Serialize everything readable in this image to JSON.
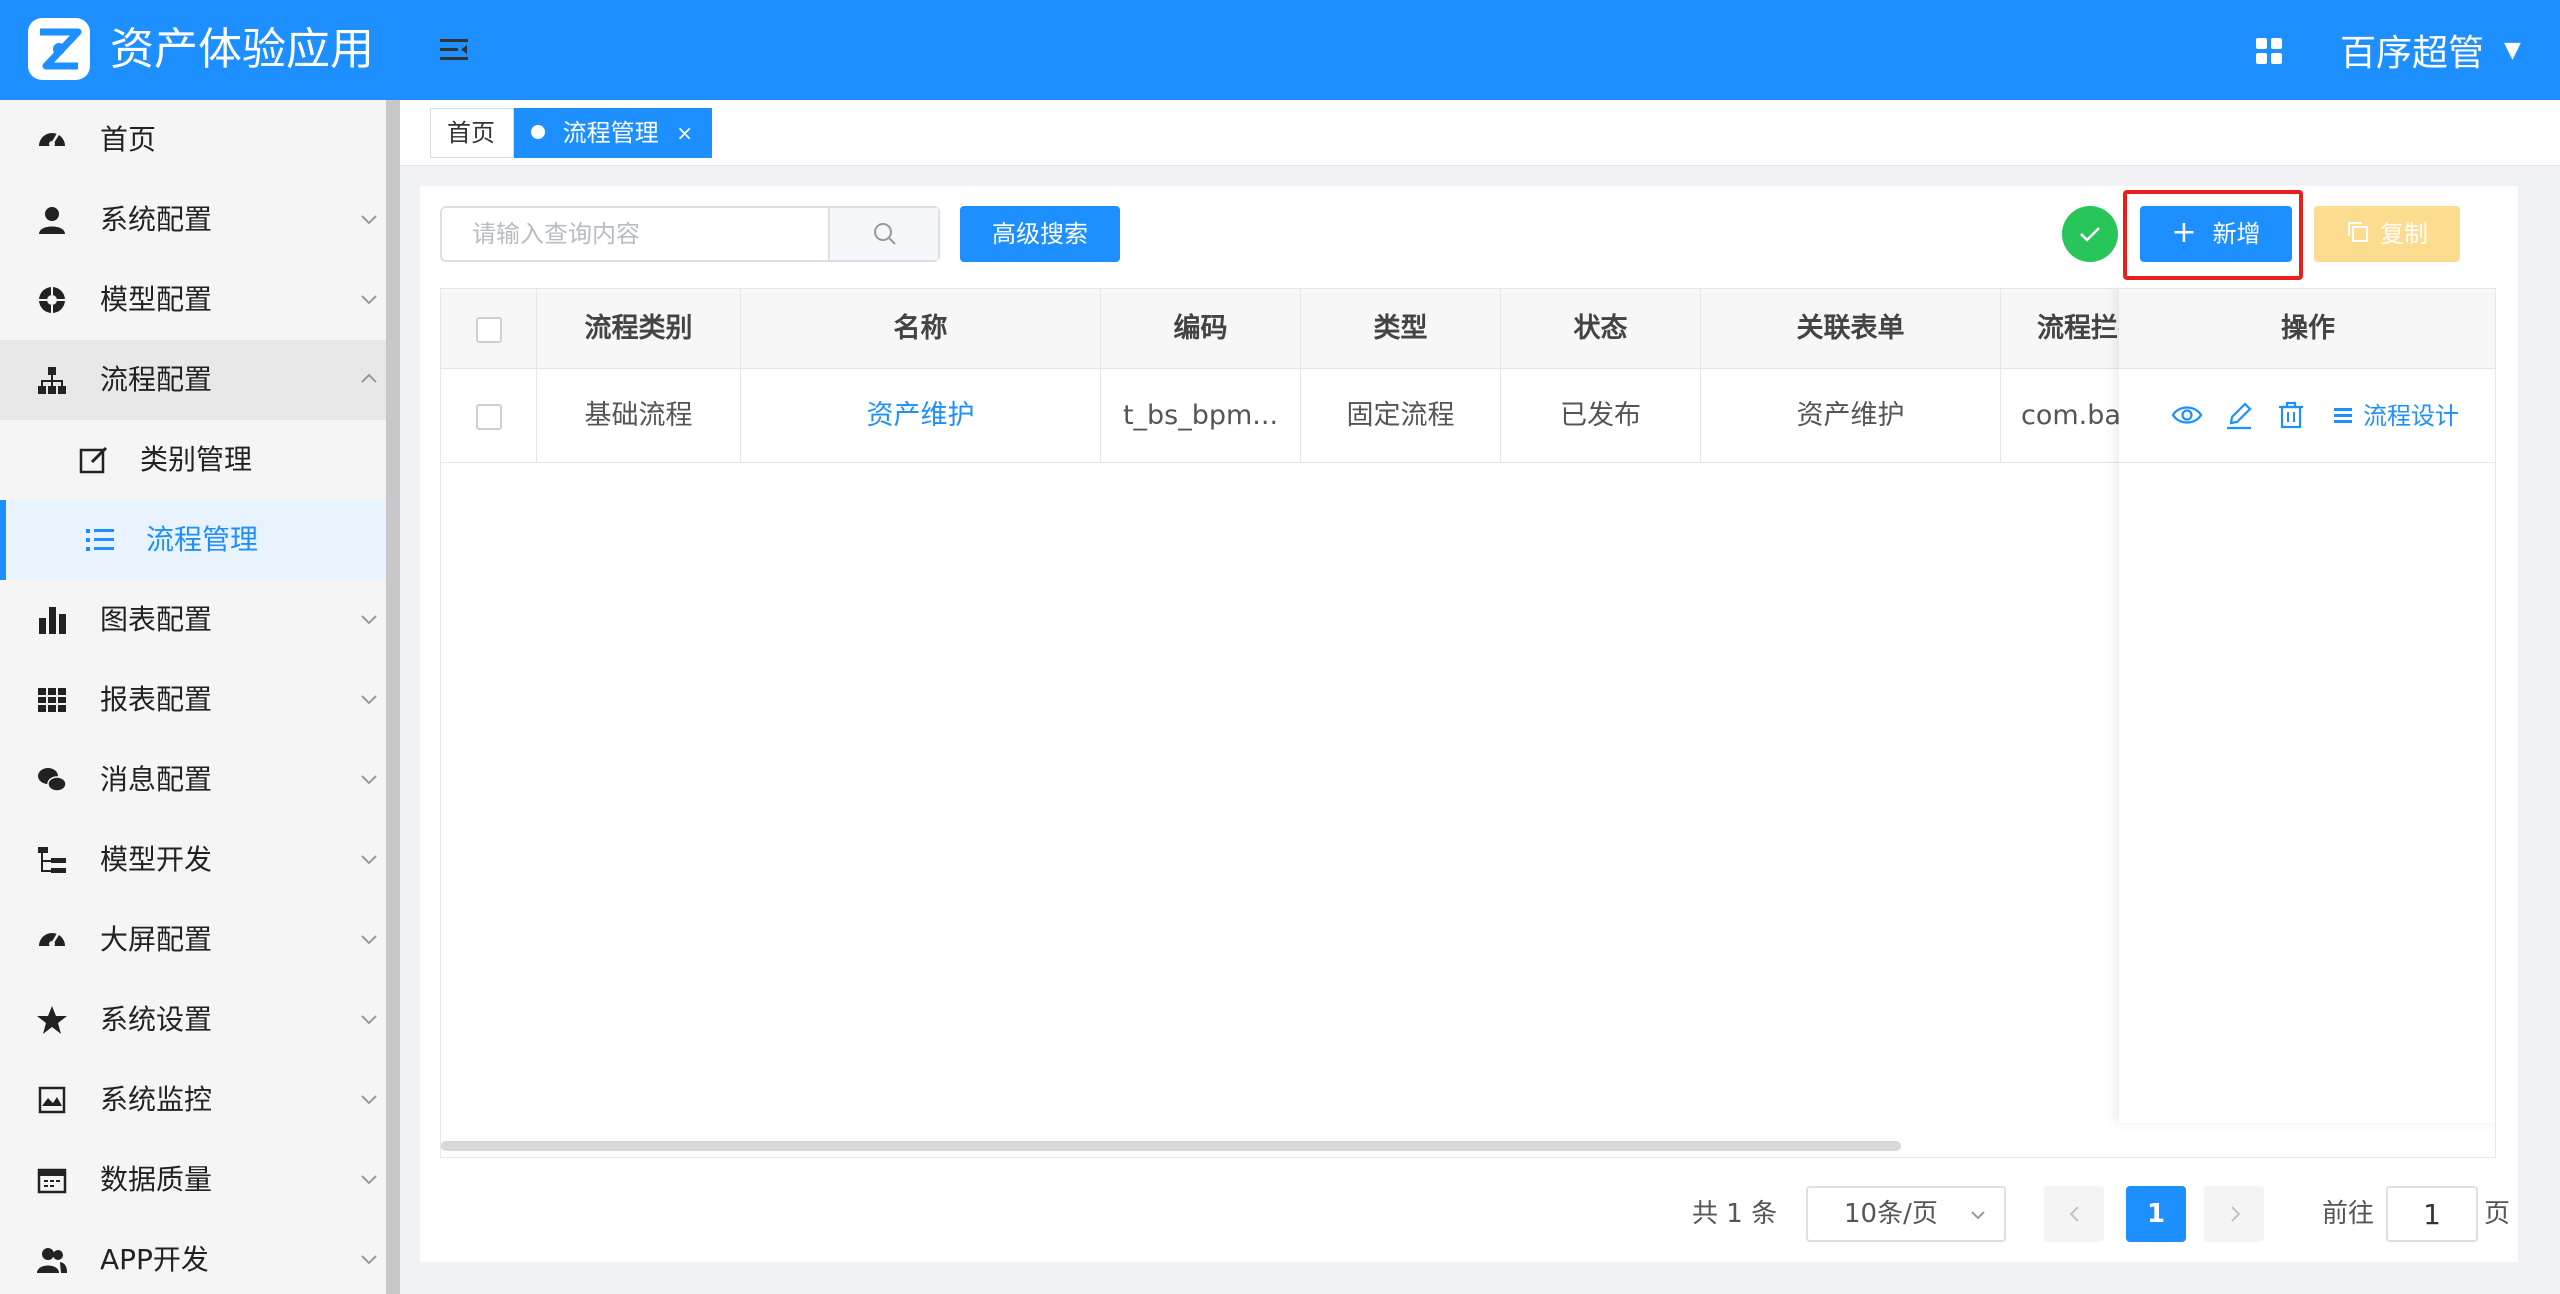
{
  "header": {
    "app_title": "资产体验应用",
    "user_name": "百序超管"
  },
  "sidebar": {
    "items": [
      {
        "label": "首页",
        "icon": "dashboard-icon"
      },
      {
        "label": "系统配置",
        "icon": "user-icon"
      },
      {
        "label": "模型配置",
        "icon": "aperture-icon"
      },
      {
        "label": "流程配置",
        "icon": "org-chart-icon"
      },
      {
        "label": "图表配置",
        "icon": "bar-chart-icon"
      },
      {
        "label": "报表配置",
        "icon": "table-icon"
      },
      {
        "label": "消息配置",
        "icon": "wechat-icon"
      },
      {
        "label": "模型开发",
        "icon": "tree-list-icon"
      },
      {
        "label": "大屏配置",
        "icon": "dashboard-icon"
      },
      {
        "label": "系统设置",
        "icon": "star-icon"
      },
      {
        "label": "系统监控",
        "icon": "monitor-icon"
      },
      {
        "label": "数据质量",
        "icon": "calendar-icon"
      },
      {
        "label": "APP开发",
        "icon": "users-icon"
      }
    ],
    "sub_items": [
      {
        "label": "类别管理",
        "icon": "edit-icon"
      },
      {
        "label": "流程管理",
        "icon": "list-icon"
      }
    ]
  },
  "tabs": [
    {
      "label": "首页"
    },
    {
      "label": "流程管理"
    }
  ],
  "toolbar": {
    "search_placeholder": "请输入查询内容",
    "advanced_search": "高级搜索",
    "add_label": "新增",
    "copy_label": "复制"
  },
  "table": {
    "columns": [
      "流程类别",
      "名称",
      "编码",
      "类型",
      "状态",
      "关联表单",
      "流程拦截",
      "操作"
    ],
    "rows": [
      {
        "category": "基础流程",
        "name": "资产维护",
        "code": "t_bs_bpm...",
        "type": "固定流程",
        "status": "已发布",
        "form": "资产维护",
        "interceptor": "com.bai",
        "design_label": "流程设计"
      }
    ]
  },
  "pagination": {
    "total": "共 1 条",
    "page_size": "10条/页",
    "current_page": "1",
    "goto_label": "前往",
    "goto_value": "1",
    "goto_suffix": "页"
  },
  "colors": {
    "primary": "#1e8fff",
    "success": "#28c55a",
    "warning_light": "#fcdc8e",
    "highlight": "#e8201b"
  }
}
